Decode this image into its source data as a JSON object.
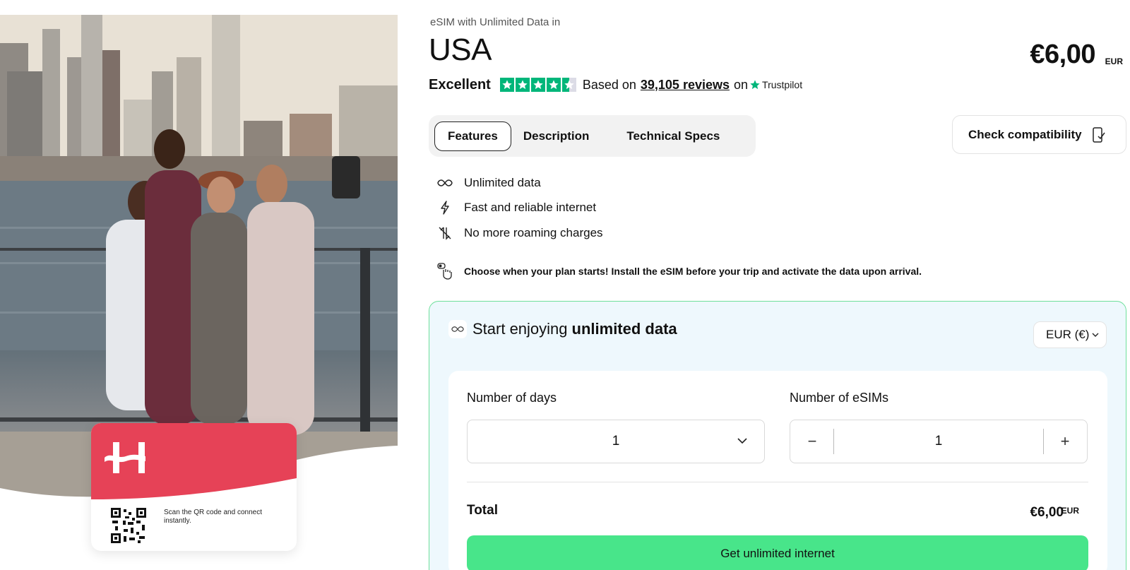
{
  "product": {
    "subtitle": "eSIM with Unlimited Data in",
    "title": "USA",
    "price": "€6,00",
    "price_currency": "EUR"
  },
  "rating": {
    "label": "Excellent",
    "stars": 4.5,
    "based_on": "Based on",
    "reviews": "39,105 reviews",
    "on": "on",
    "provider": "Trustpilot",
    "star_color": "#00b67a"
  },
  "tabs": [
    {
      "label": "Features",
      "active": true
    },
    {
      "label": "Description",
      "active": false
    },
    {
      "label": "Technical Specs",
      "active": false
    }
  ],
  "check_compatibility": {
    "label": "Check compatibility",
    "icon": "phone-check-icon"
  },
  "features": [
    {
      "icon": "infinity-icon",
      "label": "Unlimited data"
    },
    {
      "icon": "lightning-icon",
      "label": "Fast and reliable internet"
    },
    {
      "icon": "no-roaming-icon",
      "label": "No more roaming charges"
    }
  ],
  "notice": {
    "icon": "hand-pointer-icon",
    "text": "Choose when your plan starts! Install the eSIM before your trip and activate the data upon arrival."
  },
  "card": {
    "qr_text": "Scan the QR code and connect instantly.",
    "brand_color": "#e64257"
  },
  "purchase": {
    "heading_prefix": "Start enjoying",
    "heading_bold": "unlimited data",
    "currency_select": "EUR (€)",
    "days_label": "Number of days",
    "days_value": "1",
    "esims_label": "Number of eSIMs",
    "esims_value": "1",
    "minus": "−",
    "plus": "+",
    "total_label": "Total",
    "total_value": "€6,00",
    "total_currency": "EUR",
    "cta": "Get unlimited internet",
    "accent": "#48e58a"
  }
}
